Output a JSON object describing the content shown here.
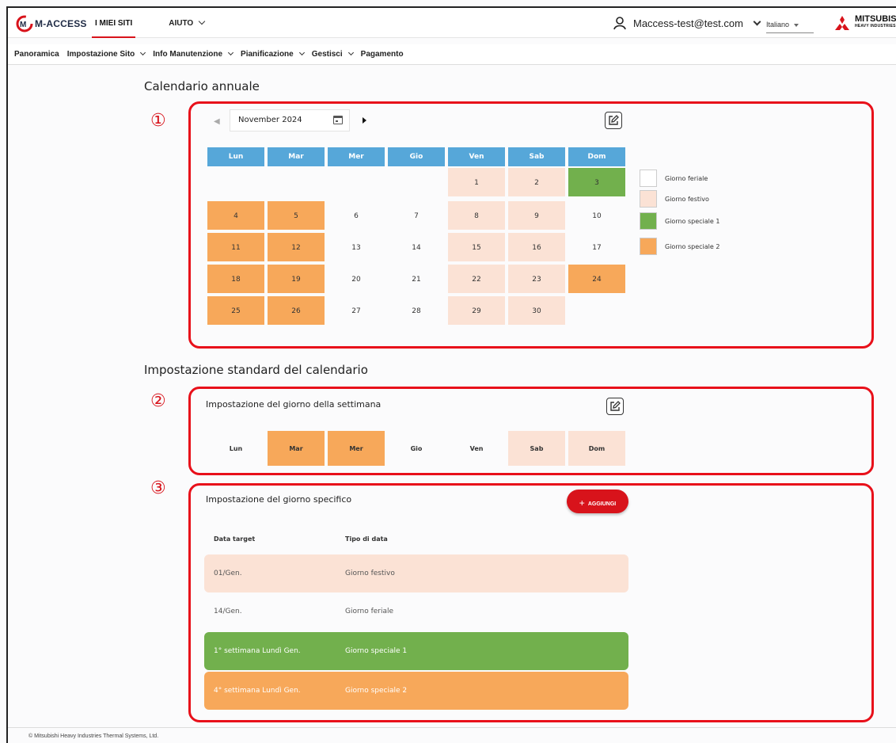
{
  "header": {
    "logo_text": "M-ACCESS",
    "nav": [
      {
        "label": "I MIEI SITI",
        "active": true,
        "dropdown": false
      },
      {
        "label": "AIUTO",
        "active": false,
        "dropdown": true
      }
    ],
    "user_email": "Maccess-test@test.com",
    "language": "Italiano",
    "brand_name": "MITSUBISHI",
    "brand_sub": "HEAVY INDUSTRIES"
  },
  "subnav": [
    {
      "label": "Panoramica",
      "dropdown": false
    },
    {
      "label": "Impostazione Sito",
      "dropdown": true
    },
    {
      "label": "Info Manutenzione",
      "dropdown": true
    },
    {
      "label": "Pianificazione",
      "dropdown": true
    },
    {
      "label": "Gestisci",
      "dropdown": true
    },
    {
      "label": "Pagamento",
      "dropdown": false
    }
  ],
  "annual": {
    "title": "Calendario annuale",
    "marker": "①",
    "month": "November 2024",
    "weekdays": [
      "Lun",
      "Mar",
      "Mer",
      "Gio",
      "Ven",
      "Sab",
      "Dom"
    ],
    "weeks": [
      [
        null,
        null,
        null,
        null,
        {
          "d": "1",
          "t": "festivo"
        },
        {
          "d": "2",
          "t": "festivo"
        },
        {
          "d": "3",
          "t": "sp1"
        }
      ],
      [
        {
          "d": "4",
          "t": "sp2"
        },
        {
          "d": "5",
          "t": "sp2"
        },
        {
          "d": "6",
          "t": "feriale"
        },
        {
          "d": "7",
          "t": "feriale"
        },
        {
          "d": "8",
          "t": "festivo"
        },
        {
          "d": "9",
          "t": "festivo"
        },
        {
          "d": "10",
          "t": "feriale"
        }
      ],
      [
        {
          "d": "11",
          "t": "sp2"
        },
        {
          "d": "12",
          "t": "sp2"
        },
        {
          "d": "13",
          "t": "feriale"
        },
        {
          "d": "14",
          "t": "feriale"
        },
        {
          "d": "15",
          "t": "festivo"
        },
        {
          "d": "16",
          "t": "festivo"
        },
        {
          "d": "17",
          "t": "feriale"
        }
      ],
      [
        {
          "d": "18",
          "t": "sp2"
        },
        {
          "d": "19",
          "t": "sp2"
        },
        {
          "d": "20",
          "t": "feriale"
        },
        {
          "d": "21",
          "t": "feriale"
        },
        {
          "d": "22",
          "t": "festivo"
        },
        {
          "d": "23",
          "t": "festivo"
        },
        {
          "d": "24",
          "t": "sp2"
        }
      ],
      [
        {
          "d": "25",
          "t": "sp2"
        },
        {
          "d": "26",
          "t": "sp2"
        },
        {
          "d": "27",
          "t": "feriale"
        },
        {
          "d": "28",
          "t": "feriale"
        },
        {
          "d": "29",
          "t": "festivo"
        },
        {
          "d": "30",
          "t": "festivo"
        },
        null
      ]
    ],
    "legend": [
      {
        "label": "Giorno feriale",
        "color": "#ffffff"
      },
      {
        "label": "Giorno festivo",
        "color": "#fbe2d5"
      },
      {
        "label": "Giorno speciale 1",
        "color": "#72b04d"
      },
      {
        "label": "Giorno speciale 2",
        "color": "#f7a85a"
      }
    ]
  },
  "standard": {
    "title": "Impostazione standard del calendario"
  },
  "weekday_setting": {
    "marker": "②",
    "title": "Impostazione del giorno della settimana",
    "days": [
      {
        "label": "Lun",
        "t": "feriale"
      },
      {
        "label": "Mar",
        "t": "sp2"
      },
      {
        "label": "Mer",
        "t": "sp2"
      },
      {
        "label": "Gio",
        "t": "feriale"
      },
      {
        "label": "Ven",
        "t": "feriale"
      },
      {
        "label": "Sab",
        "t": "festivo"
      },
      {
        "label": "Dom",
        "t": "festivo"
      }
    ]
  },
  "specific_setting": {
    "marker": "③",
    "title": "Impostazione del giorno specifico",
    "add_label": "AGGIUNGI",
    "col_date": "Data target",
    "col_type": "Tipo di data",
    "rows": [
      {
        "date": "01/Gen.",
        "type": "Giorno festivo",
        "t": "festivo"
      },
      {
        "date": "14/Gen.",
        "type": "Giorno feriale",
        "t": "feriale"
      },
      {
        "date": "1° settimana Lundì Gen.",
        "type": "Giorno speciale 1",
        "t": "sp1"
      },
      {
        "date": "4° settimana Lundì Gen.",
        "type": "Giorno speciale 2",
        "t": "sp2"
      }
    ]
  },
  "footer": "© Mitsubishi Heavy Industries Thermal Systems, Ltd."
}
